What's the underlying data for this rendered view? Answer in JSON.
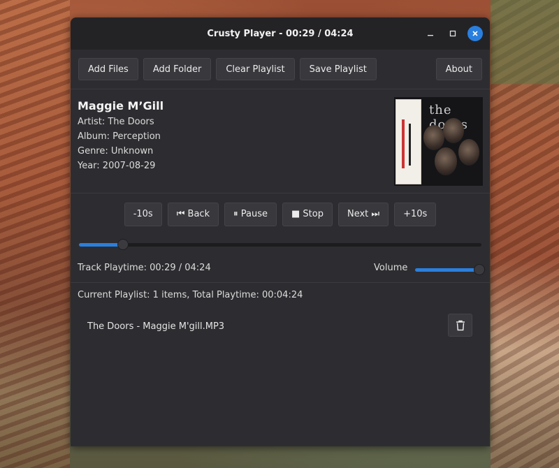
{
  "window": {
    "title": "Crusty Player - 00:29 / 04:24"
  },
  "toolbar": {
    "add_files": "Add Files",
    "add_folder": "Add Folder",
    "clear_playlist": "Clear Playlist",
    "save_playlist": "Save Playlist",
    "about": "About"
  },
  "track": {
    "title": "Maggie M’Gill",
    "artist": "Artist: The Doors",
    "album": "Album: Perception",
    "genre": "Genre: Unknown",
    "year": "Year: 2007-08-29",
    "cover_logo": "the doors"
  },
  "controls": {
    "back10": "-10s",
    "back": "⏮ Back",
    "pause": "⏸ Pause",
    "stop": "■ Stop",
    "next": "Next ⏭",
    "fwd10": "+10s"
  },
  "progress": {
    "fraction": 0.11
  },
  "status": {
    "playtime": "Track Playtime: 00:29 / 04:24",
    "volume_label": "Volume",
    "volume_fraction": 1.0
  },
  "playlist": {
    "summary": "Current Playlist: 1 items, Total Playtime: 00:04:24",
    "items": [
      {
        "name": "The Doors - Maggie M'gill.MP3"
      }
    ]
  },
  "colors": {
    "accent": "#2a7fde",
    "window_bg": "#2d2d31",
    "titlebar_bg": "#232326"
  },
  "icons": {
    "delete": "trash-icon",
    "close": "close-icon",
    "minimize": "minimize-icon",
    "maximize": "maximize-icon"
  }
}
